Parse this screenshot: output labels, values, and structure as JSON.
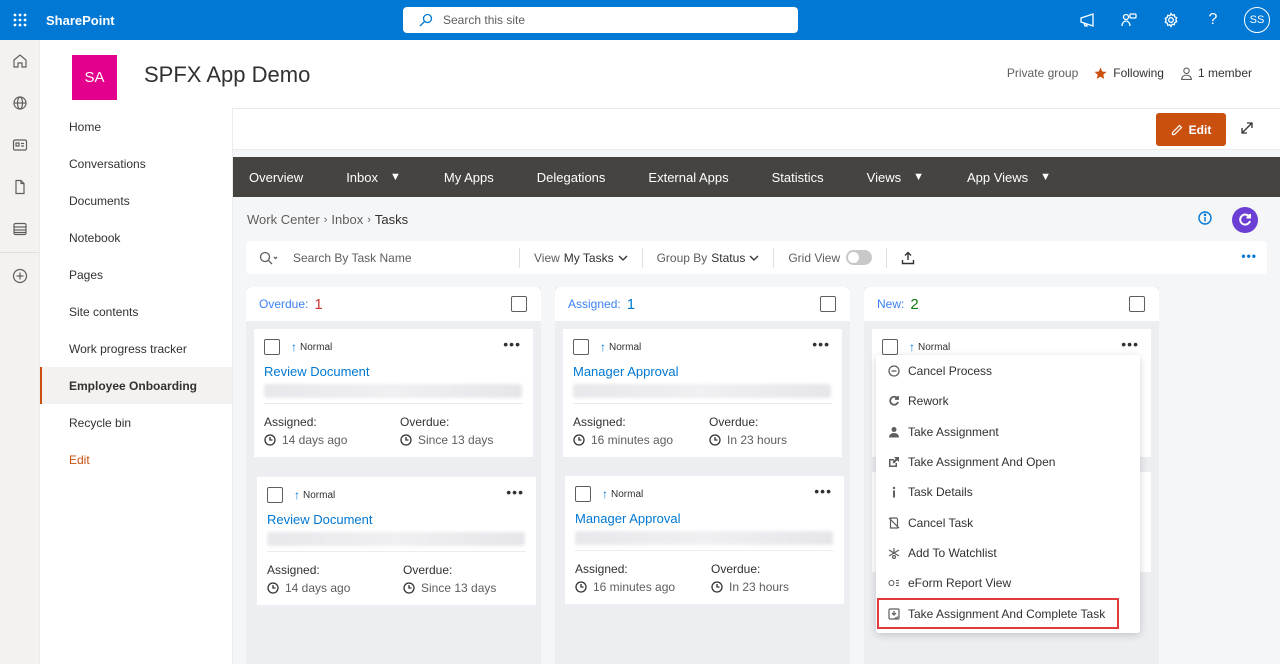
{
  "suite_bar": {
    "brand": "SharePoint",
    "search_placeholder": "Search this site",
    "avatar_initials": "SS",
    "color": "#0078d4"
  },
  "site": {
    "logo_initials": "SA",
    "logo_color": "#e3008c",
    "title": "SPFX App Demo",
    "privacy": "Private group",
    "following": "Following",
    "members": "1 member"
  },
  "left_nav": {
    "items": [
      {
        "label": "Home"
      },
      {
        "label": "Conversations"
      },
      {
        "label": "Documents"
      },
      {
        "label": "Notebook"
      },
      {
        "label": "Pages"
      },
      {
        "label": "Site contents"
      },
      {
        "label": "Work progress tracker"
      },
      {
        "label": "Employee Onboarding",
        "active": true
      },
      {
        "label": "Recycle bin"
      },
      {
        "label": "Edit"
      }
    ]
  },
  "command_bar": {
    "edit_label": "Edit",
    "edit_color": "#ca5010"
  },
  "top_nav": {
    "items": [
      {
        "label": "Overview",
        "dropdown": false
      },
      {
        "label": "Inbox",
        "dropdown": true
      },
      {
        "label": "My Apps",
        "dropdown": false
      },
      {
        "label": "Delegations",
        "dropdown": false
      },
      {
        "label": "External Apps",
        "dropdown": false
      },
      {
        "label": "Statistics",
        "dropdown": false
      },
      {
        "label": "Views",
        "dropdown": true
      },
      {
        "label": "App Views",
        "dropdown": true
      }
    ],
    "caret": "▼"
  },
  "breadcrumb": [
    "Work Center",
    "Inbox",
    "Tasks"
  ],
  "toolbar": {
    "search_placeholder": "Search By Task Name",
    "view_label": "View",
    "view_value": "My Tasks",
    "group_label": "Group By",
    "group_value": "Status",
    "grid_view_label": "Grid View",
    "grid_view_on": false
  },
  "columns": [
    {
      "label": "Overdue:",
      "count": "1",
      "count_color": "#d13438",
      "cards": [
        {
          "priority": "Normal",
          "title": "Review Document",
          "assigned_label": "Assigned:",
          "assigned": "14 days ago",
          "overdue_label": "Overdue:",
          "overdue": "Since 13 days"
        }
      ]
    },
    {
      "label": "Assigned:",
      "count": "1",
      "count_color": "#0078d4",
      "cards": [
        {
          "priority": "Normal",
          "title": "Manager Approval",
          "assigned_label": "Assigned:",
          "assigned": "16 minutes ago",
          "overdue_label": "Overdue:",
          "overdue": "In 23 hours"
        }
      ]
    },
    {
      "label": "New:",
      "count": "2",
      "count_color": "#107c10",
      "cards": [
        {
          "priority": "Normal"
        }
      ]
    }
  ],
  "extra_cards": [
    {
      "priority": "Normal",
      "title": "Review Document",
      "assigned_label": "Assigned:",
      "assigned": "14 days ago",
      "overdue_label": "Overdue:",
      "overdue": "Since 13 days"
    },
    {
      "priority": "Normal",
      "title": "Manager Approval",
      "assigned_label": "Assigned:",
      "assigned": "16 minutes ago",
      "overdue_label": "Overdue:",
      "overdue": "In 23 hours"
    }
  ],
  "context_menu": {
    "items": [
      {
        "label": "Cancel Process",
        "icon": "cancel-circle-icon"
      },
      {
        "label": "Rework",
        "icon": "refresh-icon"
      },
      {
        "label": "Take Assignment",
        "icon": "person-icon"
      },
      {
        "label": "Take Assignment And Open",
        "icon": "open-external-icon"
      },
      {
        "label": "Task Details",
        "icon": "info-icon"
      },
      {
        "label": "Cancel Task",
        "icon": "cancel-task-icon"
      },
      {
        "label": "Add To Watchlist",
        "icon": "watchlist-icon"
      },
      {
        "label": "eForm Report View",
        "icon": "report-icon"
      },
      {
        "label": "Take Assignment And Complete Task",
        "icon": "complete-task-icon",
        "highlighted": true
      }
    ]
  }
}
